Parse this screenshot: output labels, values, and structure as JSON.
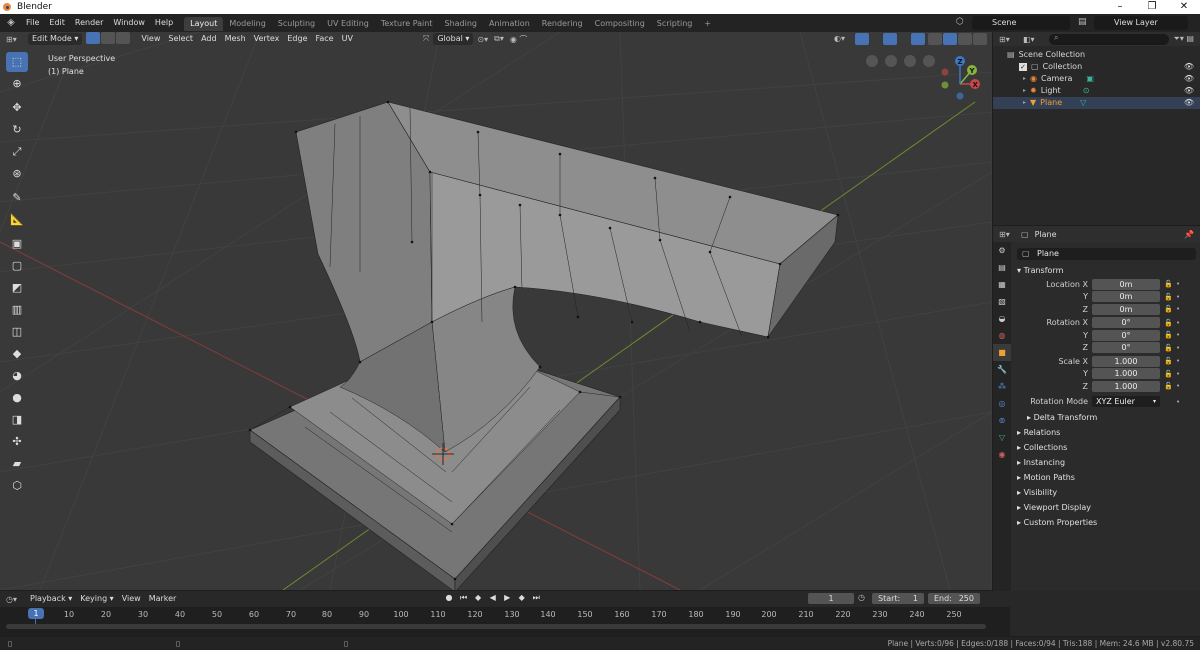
{
  "app": {
    "title": "Blender"
  },
  "menu": [
    "File",
    "Edit",
    "Render",
    "Window",
    "Help"
  ],
  "workspaces": [
    "Layout",
    "Modeling",
    "Sculpting",
    "UV Editing",
    "Texture Paint",
    "Shading",
    "Animation",
    "Rendering",
    "Compositing",
    "Scripting"
  ],
  "workspace_add": "+",
  "scene": {
    "name": "Scene",
    "view_layer": "View Layer"
  },
  "viewport": {
    "mode": "Edit Mode",
    "menus": [
      "View",
      "Select",
      "Add",
      "Mesh",
      "Vertex",
      "Edge",
      "Face",
      "UV"
    ],
    "orientation": "Global",
    "view_name": "User Perspective",
    "object_label": "(1) Plane"
  },
  "gizmo": {
    "x": "X",
    "y": "Y",
    "z": "Z"
  },
  "outliner": {
    "rows": [
      {
        "label": "Scene Collection"
      },
      {
        "label": "Collection"
      },
      {
        "label": "Camera"
      },
      {
        "label": "Light"
      },
      {
        "label": "Plane"
      }
    ]
  },
  "properties": {
    "header": "Plane",
    "object_name": "Plane",
    "transform": {
      "title": "Transform",
      "location_label": "Location X",
      "rotation_label": "Rotation X",
      "scale_label": "Scale X",
      "y": "Y",
      "z": "Z",
      "location": [
        "0m",
        "0m",
        "0m"
      ],
      "rotation": [
        "0°",
        "0°",
        "0°"
      ],
      "scale": [
        "1.000",
        "1.000",
        "1.000"
      ],
      "rotation_mode_label": "Rotation Mode",
      "rotation_mode": "XYZ Euler",
      "delta": "Delta Transform"
    },
    "panels": [
      "Relations",
      "Collections",
      "Instancing",
      "Motion Paths",
      "Visibility",
      "Viewport Display",
      "Custom Properties"
    ]
  },
  "timeline": {
    "menus": [
      "Playback",
      "Keying",
      "View",
      "Marker"
    ],
    "current_frame": "1",
    "start_label": "Start:",
    "start": "1",
    "end_label": "End:",
    "end": "250",
    "frames": [
      "1",
      "10",
      "20",
      "30",
      "40",
      "50",
      "60",
      "70",
      "80",
      "90",
      "100",
      "110",
      "120",
      "130",
      "140",
      "150",
      "160",
      "170",
      "180",
      "190",
      "200",
      "210",
      "220",
      "230",
      "240",
      "250"
    ]
  },
  "status": "Plane | Verts:0/96 | Edges:0/188 | Faces:0/94 | Tris:188 | Mem: 24.6 MB | v2.80.75",
  "colors": {
    "accent": "#4772b3",
    "active_object": "#f0a032",
    "x_axis": "#c84848",
    "y_axis": "#86b43c",
    "z_axis": "#3c78c8"
  }
}
